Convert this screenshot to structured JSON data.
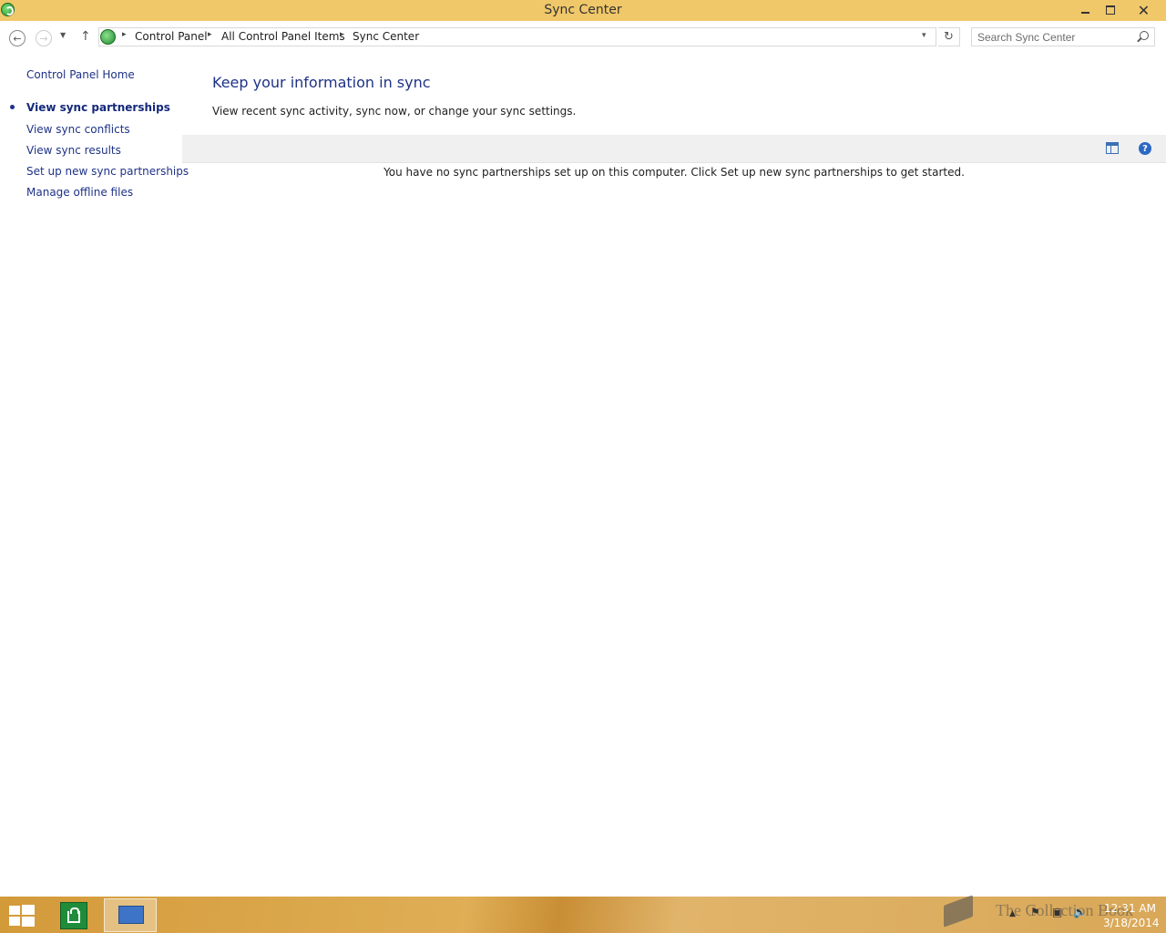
{
  "window": {
    "title": "Sync Center",
    "close_glyph": "✕"
  },
  "navigation": {
    "back_glyph": "←",
    "forward_glyph": "→",
    "recent_glyph": "▼",
    "up_glyph": "↑",
    "breadcrumbs": [
      "Control Panel",
      "All Control Panel Items",
      "Sync Center"
    ],
    "separator_glyph": "▸",
    "dropdown_glyph": "▾",
    "refresh_glyph": "↻",
    "search_placeholder": "Search Sync Center"
  },
  "sidebar": {
    "home": "Control Panel Home",
    "items": [
      {
        "label": "View sync partnerships",
        "active": true
      },
      {
        "label": "View sync conflicts"
      },
      {
        "label": "View sync results"
      },
      {
        "label": "Set up new sync partnerships"
      },
      {
        "label": "Manage offline files"
      }
    ]
  },
  "main": {
    "heading": "Keep your information in sync",
    "description": "View recent sync activity, sync now, or change your sync settings.",
    "help_glyph": "?",
    "empty_message": "You have no sync partnerships set up on this computer. Click Set up new sync partnerships to get started."
  },
  "taskbar": {
    "watermark": "The Collection Book",
    "tray_glyphs": {
      "up": "▲",
      "flag": "⚑",
      "network": "▣",
      "volume": "🔈"
    },
    "time": "12:31 AM",
    "date": "3/18/2014"
  },
  "icons": [
    "sync-icon",
    "back-icon",
    "forward-icon",
    "recent-pages-icon",
    "up-icon",
    "refresh-icon",
    "search-icon",
    "layout-icon",
    "help-icon",
    "windows-start-icon",
    "store-icon",
    "control-panel-icon",
    "book-icon",
    "flag-icon",
    "network-icon",
    "volume-icon"
  ]
}
